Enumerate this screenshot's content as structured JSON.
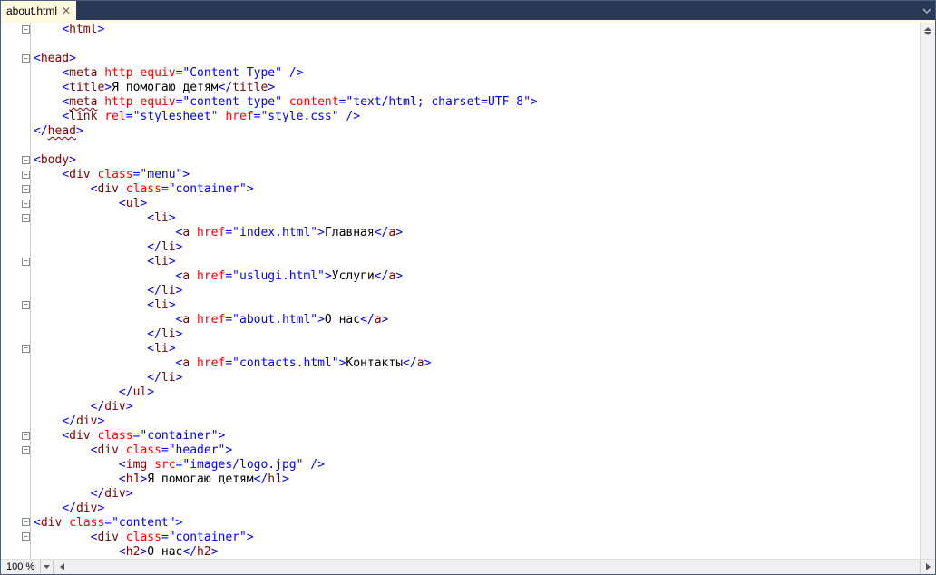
{
  "tab": {
    "name": "about.html"
  },
  "zoom": "100 %",
  "code": [
    [
      [
        4,
        "<",
        "br"
      ],
      [
        "html",
        "tag"
      ],
      [
        ">",
        "br"
      ]
    ],
    [],
    [
      [
        0,
        "<",
        "br"
      ],
      [
        "head",
        "tag"
      ],
      [
        ">",
        "br"
      ]
    ],
    [
      [
        4,
        "<",
        "br"
      ],
      [
        "meta",
        "tag"
      ],
      [
        " ",
        ""
      ],
      [
        "http-equiv",
        "attr"
      ],
      [
        "=",
        "br"
      ],
      [
        "\"Content-Type\"",
        "val"
      ],
      [
        " />",
        "br"
      ]
    ],
    [
      [
        4,
        "<",
        "br"
      ],
      [
        "title",
        "tag"
      ],
      [
        ">",
        "br"
      ],
      [
        "Я помогаю детям",
        "txt"
      ],
      [
        "</",
        "br"
      ],
      [
        "title",
        "tag"
      ],
      [
        ">",
        "br"
      ]
    ],
    [
      [
        4,
        "<",
        "br"
      ],
      [
        "meta",
        "tag",
        "u"
      ],
      [
        " ",
        ""
      ],
      [
        "http-equiv",
        "attr"
      ],
      [
        "=",
        "br"
      ],
      [
        "\"content-type\"",
        "val"
      ],
      [
        " ",
        ""
      ],
      [
        "content",
        "attr"
      ],
      [
        "=",
        "br"
      ],
      [
        "\"text/html; charset=UTF-8\"",
        "val"
      ],
      [
        ">",
        "br"
      ]
    ],
    [
      [
        4,
        "<",
        "br"
      ],
      [
        "link",
        "tag"
      ],
      [
        " ",
        ""
      ],
      [
        "rel",
        "attr"
      ],
      [
        "=",
        "br"
      ],
      [
        "\"stylesheet\"",
        "val"
      ],
      [
        " ",
        ""
      ],
      [
        "href",
        "attr"
      ],
      [
        "=",
        "br"
      ],
      [
        "\"style.css\"",
        "val"
      ],
      [
        " />",
        "br"
      ]
    ],
    [
      [
        0,
        "</",
        "br"
      ],
      [
        "head",
        "tag",
        "u"
      ],
      [
        ">",
        "br"
      ]
    ],
    [],
    [
      [
        0,
        "<",
        "br"
      ],
      [
        "body",
        "tag"
      ],
      [
        ">",
        "br"
      ]
    ],
    [
      [
        4,
        "<",
        "br"
      ],
      [
        "div",
        "tag"
      ],
      [
        " ",
        ""
      ],
      [
        "class",
        "attr"
      ],
      [
        "=",
        "br"
      ],
      [
        "\"menu\"",
        "val"
      ],
      [
        ">",
        "br"
      ]
    ],
    [
      [
        8,
        "<",
        "br"
      ],
      [
        "div",
        "tag"
      ],
      [
        " ",
        ""
      ],
      [
        "class",
        "attr"
      ],
      [
        "=",
        "br"
      ],
      [
        "\"container\"",
        "val"
      ],
      [
        ">",
        "br"
      ]
    ],
    [
      [
        12,
        "<",
        "br"
      ],
      [
        "ul",
        "tag"
      ],
      [
        ">",
        "br"
      ]
    ],
    [
      [
        16,
        "<",
        "br"
      ],
      [
        "li",
        "tag"
      ],
      [
        ">",
        "br"
      ]
    ],
    [
      [
        20,
        "<",
        "br"
      ],
      [
        "a",
        "tag"
      ],
      [
        " ",
        ""
      ],
      [
        "href",
        "attr"
      ],
      [
        "=",
        "br"
      ],
      [
        "\"index.html\"",
        "val"
      ],
      [
        ">",
        "br"
      ],
      [
        "Главная",
        "txt"
      ],
      [
        "</",
        "br"
      ],
      [
        "a",
        "tag"
      ],
      [
        ">",
        "br"
      ]
    ],
    [
      [
        16,
        "</",
        "br"
      ],
      [
        "li",
        "tag"
      ],
      [
        ">",
        "br"
      ]
    ],
    [
      [
        16,
        "<",
        "br"
      ],
      [
        "li",
        "tag"
      ],
      [
        ">",
        "br"
      ]
    ],
    [
      [
        20,
        "<",
        "br"
      ],
      [
        "a",
        "tag"
      ],
      [
        " ",
        ""
      ],
      [
        "href",
        "attr"
      ],
      [
        "=",
        "br"
      ],
      [
        "\"uslugi.html\"",
        "val"
      ],
      [
        ">",
        "br"
      ],
      [
        "Услуги",
        "txt"
      ],
      [
        "</",
        "br"
      ],
      [
        "a",
        "tag"
      ],
      [
        ">",
        "br"
      ]
    ],
    [
      [
        16,
        "</",
        "br"
      ],
      [
        "li",
        "tag"
      ],
      [
        ">",
        "br"
      ]
    ],
    [
      [
        16,
        "<",
        "br"
      ],
      [
        "li",
        "tag"
      ],
      [
        ">",
        "br"
      ]
    ],
    [
      [
        20,
        "<",
        "br"
      ],
      [
        "a",
        "tag"
      ],
      [
        " ",
        ""
      ],
      [
        "href",
        "attr"
      ],
      [
        "=",
        "br"
      ],
      [
        "\"about.html\"",
        "val"
      ],
      [
        ">",
        "br"
      ],
      [
        "О нас",
        "txt"
      ],
      [
        "</",
        "br"
      ],
      [
        "a",
        "tag"
      ],
      [
        ">",
        "br"
      ]
    ],
    [
      [
        16,
        "</",
        "br"
      ],
      [
        "li",
        "tag"
      ],
      [
        ">",
        "br"
      ]
    ],
    [
      [
        16,
        "<",
        "br"
      ],
      [
        "li",
        "tag"
      ],
      [
        ">",
        "br"
      ]
    ],
    [
      [
        20,
        "<",
        "br"
      ],
      [
        "a",
        "tag"
      ],
      [
        " ",
        ""
      ],
      [
        "href",
        "attr"
      ],
      [
        "=",
        "br"
      ],
      [
        "\"contacts.html\"",
        "val"
      ],
      [
        ">",
        "br"
      ],
      [
        "Контакты",
        "txt"
      ],
      [
        "</",
        "br"
      ],
      [
        "a",
        "tag"
      ],
      [
        ">",
        "br"
      ]
    ],
    [
      [
        16,
        "</",
        "br"
      ],
      [
        "li",
        "tag"
      ],
      [
        ">",
        "br"
      ]
    ],
    [
      [
        12,
        "</",
        "br"
      ],
      [
        "ul",
        "tag"
      ],
      [
        ">",
        "br"
      ]
    ],
    [
      [
        8,
        "</",
        "br"
      ],
      [
        "div",
        "tag"
      ],
      [
        ">",
        "br"
      ]
    ],
    [
      [
        4,
        "</",
        "br"
      ],
      [
        "div",
        "tag"
      ],
      [
        ">",
        "br"
      ]
    ],
    [
      [
        4,
        "<",
        "br"
      ],
      [
        "div",
        "tag"
      ],
      [
        " ",
        ""
      ],
      [
        "class",
        "attr"
      ],
      [
        "=",
        "br"
      ],
      [
        "\"container\"",
        "val"
      ],
      [
        ">",
        "br"
      ]
    ],
    [
      [
        8,
        "<",
        "br"
      ],
      [
        "div",
        "tag"
      ],
      [
        " ",
        ""
      ],
      [
        "class",
        "attr"
      ],
      [
        "=",
        "br"
      ],
      [
        "\"header\"",
        "val"
      ],
      [
        ">",
        "br"
      ]
    ],
    [
      [
        12,
        "<",
        "br"
      ],
      [
        "img",
        "tag"
      ],
      [
        " ",
        ""
      ],
      [
        "src",
        "attr"
      ],
      [
        "=",
        "br"
      ],
      [
        "\"images/logo.jpg\"",
        "val"
      ],
      [
        " />",
        "br"
      ]
    ],
    [
      [
        12,
        "<",
        "br"
      ],
      [
        "h1",
        "tag"
      ],
      [
        ">",
        "br"
      ],
      [
        "Я помогаю детям",
        "txt"
      ],
      [
        "</",
        "br"
      ],
      [
        "h1",
        "tag"
      ],
      [
        ">",
        "br"
      ]
    ],
    [
      [
        8,
        "</",
        "br"
      ],
      [
        "div",
        "tag"
      ],
      [
        ">",
        "br"
      ]
    ],
    [
      [
        4,
        "</",
        "br"
      ],
      [
        "div",
        "tag"
      ],
      [
        ">",
        "br"
      ]
    ],
    [
      [
        0,
        "<",
        "br"
      ],
      [
        "div",
        "tag"
      ],
      [
        " ",
        ""
      ],
      [
        "class",
        "attr"
      ],
      [
        "=",
        "br"
      ],
      [
        "\"content\"",
        "val"
      ],
      [
        ">",
        "br"
      ]
    ],
    [
      [
        8,
        "<",
        "br"
      ],
      [
        "div",
        "tag"
      ],
      [
        " ",
        ""
      ],
      [
        "class",
        "attr"
      ],
      [
        "=",
        "br"
      ],
      [
        "\"container\"",
        "val"
      ],
      [
        ">",
        "br"
      ]
    ],
    [
      [
        12,
        "<",
        "br"
      ],
      [
        "h2",
        "tag"
      ],
      [
        ">",
        "br"
      ],
      [
        "О нас",
        "txt"
      ],
      [
        "</",
        "br"
      ],
      [
        "h2",
        "tag"
      ],
      [
        ">",
        "br"
      ]
    ]
  ],
  "fold": [
    0,
    2,
    9,
    10,
    11,
    12,
    13,
    16,
    19,
    22,
    28,
    29,
    34,
    35
  ]
}
